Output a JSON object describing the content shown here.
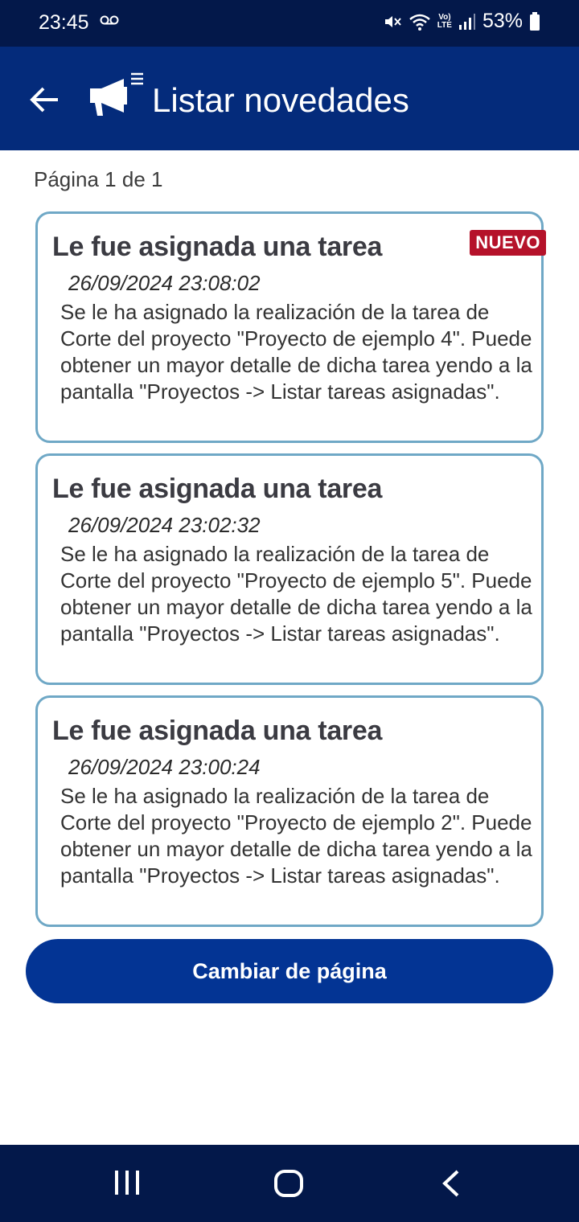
{
  "status_bar": {
    "time": "23:45",
    "battery": "53%",
    "network_label_top": "Vo)",
    "network_label_bottom": "LTE",
    "icons": [
      "voicemail-icon",
      "mute-icon",
      "wifi-icon",
      "signal-icon",
      "battery-icon"
    ]
  },
  "header": {
    "title": "Listar novedades",
    "back_icon": "arrow-left-icon",
    "title_icon": "megaphone-icon"
  },
  "pagination": {
    "label": "Página 1 de 1"
  },
  "notifications": [
    {
      "title": "Le fue asignada una tarea",
      "date": "26/09/2024 23:08:02",
      "body": "Se le ha asignado la realización de la tarea de Corte del proyecto \"Proyecto de ejemplo 4\". Puede obtener un mayor detalle de dicha tarea yendo a la pantalla \"Proyectos -> Listar tareas asignadas\".",
      "badge": "NUEVO"
    },
    {
      "title": "Le fue asignada una tarea",
      "date": "26/09/2024 23:02:32",
      "body": "Se le ha asignado la realización de la tarea de Corte del proyecto \"Proyecto de ejemplo 5\". Puede obtener un mayor detalle de dicha tarea yendo a la pantalla \"Proyectos -> Listar tareas asignadas\"."
    },
    {
      "title": "Le fue asignada una tarea",
      "date": "26/09/2024 23:00:24",
      "body": "Se le ha asignado la realización de la tarea de Corte del proyecto \"Proyecto de ejemplo 2\". Puede obtener un mayor detalle de dicha tarea yendo a la pantalla \"Proyectos -> Listar tareas asignadas\"."
    }
  ],
  "actions": {
    "change_page_label": "Cambiar de página"
  },
  "colors": {
    "app_bar": "#042b7b",
    "status_bar": "#03184a",
    "button": "#033494",
    "card_border": "#6fa8c6",
    "badge": "#b5122a"
  },
  "nav_bar": {
    "icons": [
      "recents-icon",
      "home-icon",
      "back-nav-icon"
    ]
  }
}
